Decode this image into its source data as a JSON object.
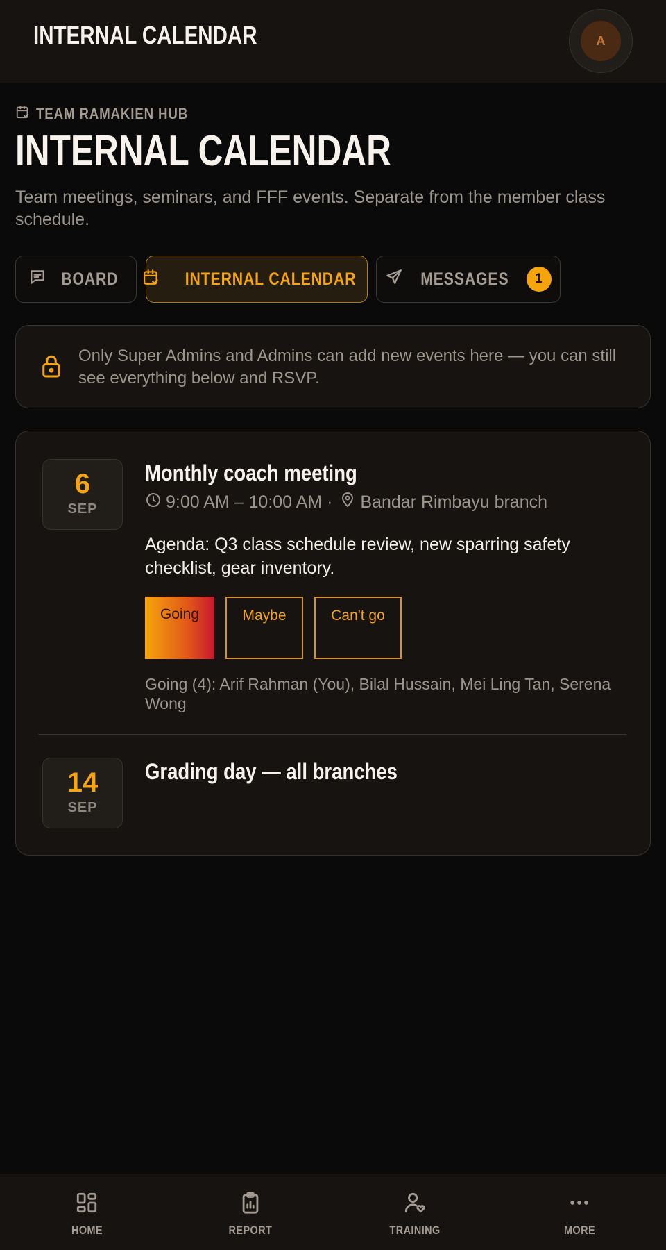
{
  "header": {
    "title": "INTERNAL CALENDAR",
    "avatar_initial": "A"
  },
  "page": {
    "eyebrow": "TEAM RAMAKIEN HUB",
    "title": "INTERNAL CALENDAR",
    "subtitle": "Team meetings, seminars, and FFF events. Separate from the member class schedule."
  },
  "tabs": [
    {
      "label": "BOARD",
      "icon": "message-square-icon",
      "active": false
    },
    {
      "label": "INTERNAL CALENDAR",
      "icon": "calendar-check-icon",
      "active": true
    },
    {
      "label": "MESSAGES",
      "icon": "send-icon",
      "active": false,
      "badge": "1"
    }
  ],
  "notice": {
    "icon": "lock-icon",
    "text": "Only Super Admins and Admins can add new events here — you can still see everything below and RSVP."
  },
  "events": [
    {
      "day": "6",
      "month": "SEP",
      "title": "Monthly coach meeting",
      "time": "9:00 AM – 10:00 AM ·",
      "location": "Bandar Rimbayu branch",
      "agenda": "Agenda: Q3 class schedule review, new sparring safety checklist, gear inventory.",
      "rsvp": {
        "going": "Going",
        "maybe": "Maybe",
        "cant": "Can't go",
        "selected": "going"
      },
      "attendees": "Going (4): Arif Rahman (You), Bilal Hussain, Mei Ling Tan, Serena Wong"
    },
    {
      "day": "14",
      "month": "SEP",
      "title": "Grading day — all branches"
    }
  ],
  "nav": [
    {
      "label": "HOME",
      "icon": "dashboard-icon"
    },
    {
      "label": "REPORT",
      "icon": "clipboard-chart-icon"
    },
    {
      "label": "TRAINING",
      "icon": "user-heart-icon"
    },
    {
      "label": "MORE",
      "icon": "more-dots-icon"
    }
  ],
  "colors": {
    "accent": "#f5a416",
    "background": "#0a0a0a",
    "surface": "#171310",
    "muted_text": "#9c958d"
  }
}
